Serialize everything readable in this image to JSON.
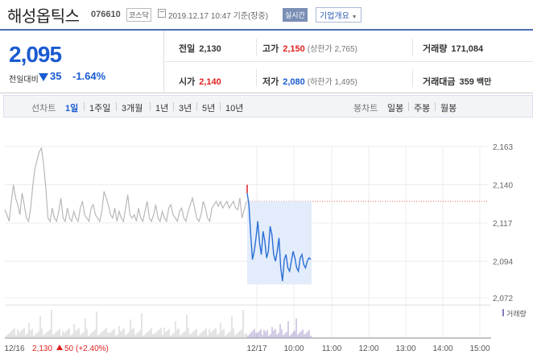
{
  "header": {
    "company_name": "해성옵틱스",
    "code": "076610",
    "market": "코스닥",
    "datetime": "2019.12.17 10:47 기준(장중)",
    "realtime_badge": "실시간",
    "company_info": "기업개요"
  },
  "price": {
    "current": "2,095",
    "change_label": "전일대비",
    "change_value": "35",
    "change_pct": "-1.64%"
  },
  "stats": {
    "prev_close": {
      "label": "전일",
      "value": "2,130"
    },
    "high": {
      "label": "고가",
      "value": "2,150",
      "sub": "(상한가 2,765)"
    },
    "volume": {
      "label": "거래량",
      "value": "171,084"
    },
    "open": {
      "label": "시가",
      "value": "2,140"
    },
    "low": {
      "label": "저가",
      "value": "2,080",
      "sub": "(하한가 1,495)"
    },
    "amount": {
      "label": "거래대금",
      "value": "359",
      "unit": "백만"
    }
  },
  "toolbar": {
    "line_label": "선차트",
    "line_periods": [
      "1일",
      "1주일",
      "3개월",
      "1년",
      "3년",
      "5년",
      "10년"
    ],
    "active_period": "1일",
    "candle_label": "봉차트",
    "candle_periods": [
      "일봉",
      "주봉",
      "월봉"
    ]
  },
  "chart_data": {
    "type": "line",
    "y_ticks": [
      "2,163",
      "2,140",
      "2,117",
      "2,094",
      "2,072"
    ],
    "ylim": [
      2072,
      2163
    ],
    "prev_close_line": 2130,
    "x_labels": [
      "12/16",
      "12/17",
      "10:00",
      "11:00",
      "12:00",
      "13:00",
      "14:00",
      "15:00"
    ],
    "prev_day_summary": {
      "price": "2,130",
      "change": "50",
      "pct": "(+2.40%)"
    },
    "volume_legend": "거래량",
    "series": [
      {
        "values": [
          2125,
          2122,
          2118,
          2130,
          2140,
          2132,
          2128,
          2122,
          2135,
          2128,
          2120,
          2118,
          2126,
          2140,
          2150,
          2155,
          2160,
          2162,
          2152,
          2138,
          2120,
          2118,
          2126,
          2120,
          2118,
          2124,
          2132,
          2120,
          2118,
          2126,
          2120,
          2118,
          2124,
          2120,
          2118,
          2126,
          2130,
          2122,
          2120,
          2118,
          2126,
          2128,
          2122,
          2120,
          2118,
          2124,
          2136,
          2132,
          2128,
          2122,
          2120,
          2126,
          2118,
          2124,
          2120,
          2118,
          2126,
          2134,
          2122,
          2120,
          2122,
          2118,
          2126,
          2120,
          2118,
          2124,
          2130,
          2120,
          2118,
          2122,
          2128,
          2120,
          2118,
          2124,
          2120,
          2118,
          2126,
          2128,
          2122,
          2120,
          2118,
          2124,
          2126,
          2120,
          2118,
          2124,
          2128,
          2132,
          2126,
          2120,
          2118,
          2122,
          2130,
          2126,
          2120,
          2118,
          2126,
          2128,
          2130,
          2127,
          2130,
          2126,
          2128,
          2130,
          2126,
          2128,
          2130,
          2126,
          2125,
          2132,
          2120,
          2125,
          2130
        ]
      },
      {
        "values": [
          2135,
          2128,
          2110,
          2095,
          2100,
          2108,
          2118,
          2105,
          2098,
          2112,
          2106,
          2096,
          2100,
          2115,
          2110,
          2098,
          2094,
          2100,
          2108,
          2090,
          2082,
          2095,
          2098,
          2090,
          2088,
          2094,
          2100,
          2096,
          2090,
          2088,
          2096,
          2098,
          2092,
          2090,
          2094,
          2096,
          2095
        ]
      }
    ]
  }
}
